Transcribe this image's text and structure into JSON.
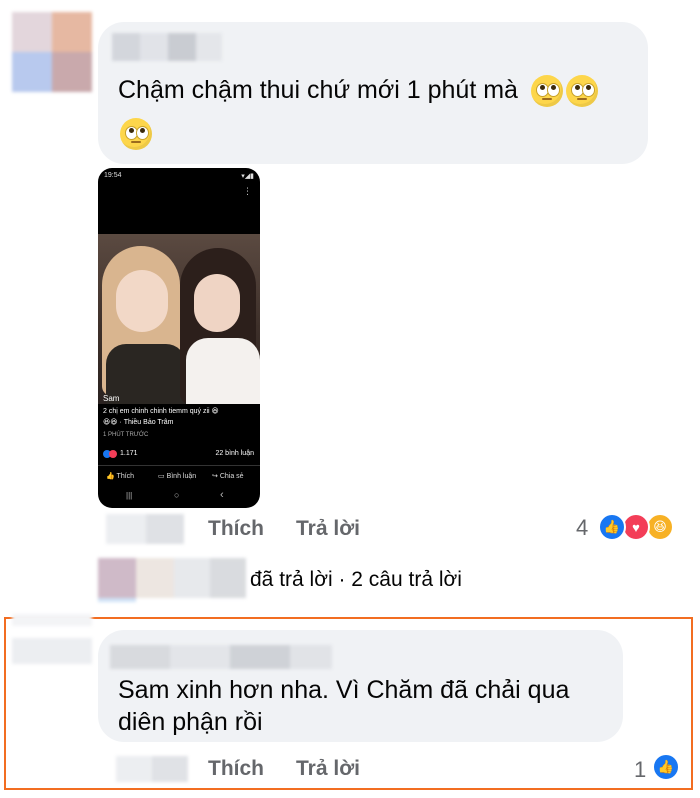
{
  "comment1": {
    "text_line1": "Chậm chậm thui chứ mới 1 phút mà",
    "emoji_name": "face-with-rolling-eyes"
  },
  "post_screenshot": {
    "status_time": "19:54",
    "author": "Sam",
    "caption": "2 chị em chinh chinh tiemm quý zii 😆",
    "tag": "😆😆 · Thiều Bảo Trâm",
    "time": "1 PHÚT TRƯỚC",
    "reactions": "1.171",
    "comments": "22 bình luận",
    "actions": [
      "Thích",
      "Bình luận",
      "Chia sẻ"
    ],
    "nav": [
      "|||",
      "○",
      "‹"
    ]
  },
  "comment1_actions": {
    "like": "Thích",
    "reply": "Trả lời",
    "reaction_count": "4"
  },
  "replies_row": {
    "text": "đã trả lời · 2 câu trả lời"
  },
  "comment2": {
    "text_line1": "Sam xinh hơn nha. Vì Chăm đã chải qua",
    "text_line2": "diên phận rồi"
  },
  "comment2_actions": {
    "like": "Thích",
    "reply": "Trả lời",
    "reaction_count": "1"
  },
  "colors": {
    "like_blue": "#1877f2",
    "love_red": "#f33e58",
    "haha_yellow": "#f7b125",
    "highlight_orange": "#f26d21",
    "bubble_bg": "#f0f2f5"
  }
}
